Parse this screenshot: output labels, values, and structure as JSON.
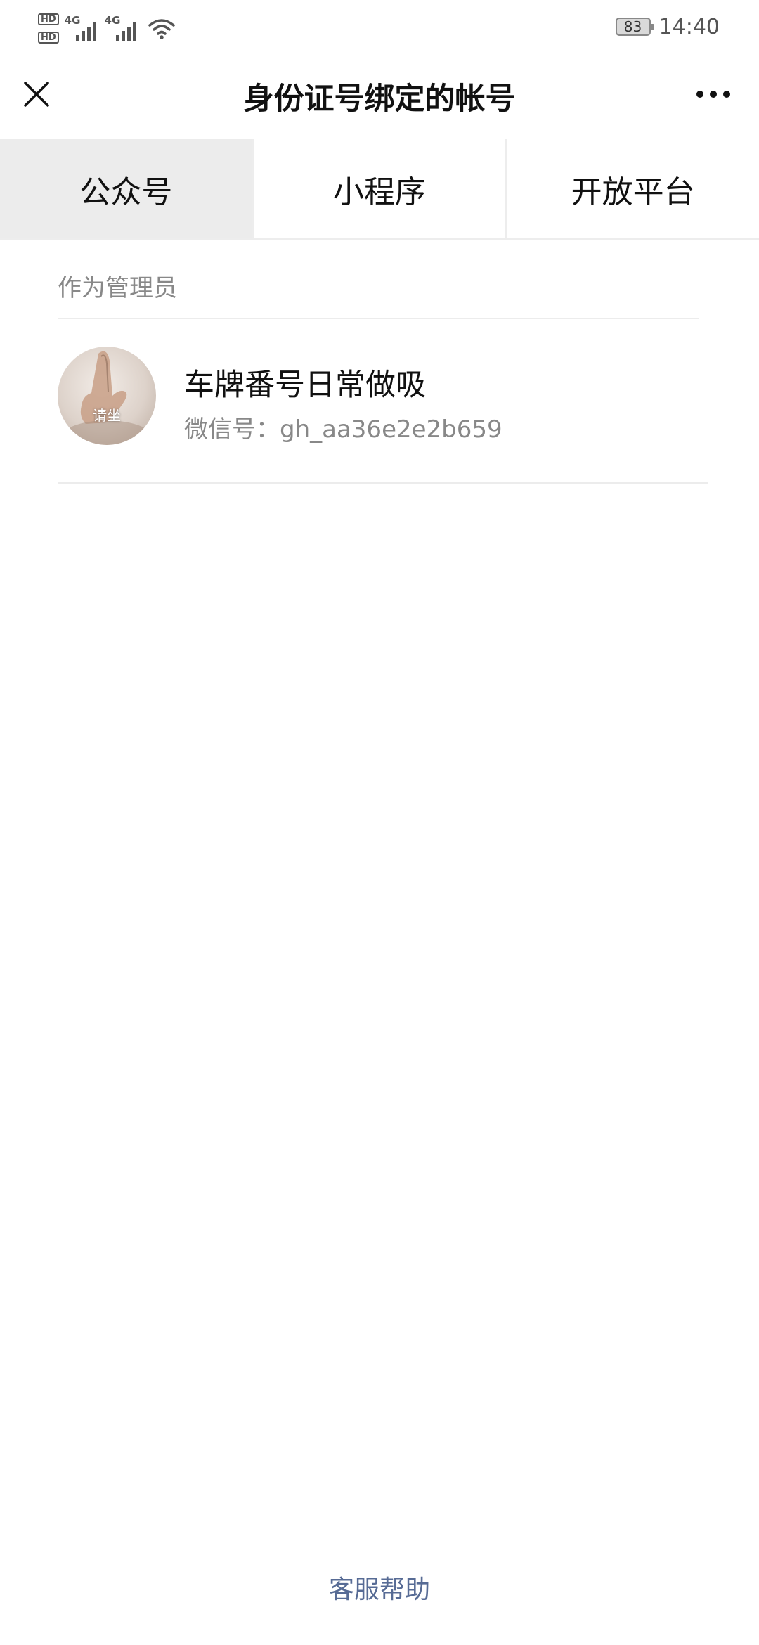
{
  "status_bar": {
    "hd_badges": [
      "HD",
      "HD"
    ],
    "sim_labels": [
      "4G",
      "4G"
    ],
    "battery_level": "83",
    "time": "14:40",
    "icons": [
      "hd-icon",
      "signal-icon",
      "signal-icon",
      "wifi-icon",
      "battery-icon"
    ]
  },
  "header": {
    "title": "身份证号绑定的帐号",
    "close_icon": "close-icon",
    "more_icon": "more-icon"
  },
  "tabs": [
    {
      "label": "公众号",
      "active": true
    },
    {
      "label": "小程序",
      "active": false
    },
    {
      "label": "开放平台",
      "active": false
    }
  ],
  "section": {
    "title": "作为管理员"
  },
  "accounts": [
    {
      "avatar_caption": "请坐",
      "name": "车牌番号日常做吸",
      "wechat_id": "微信号：gh_aa36e2e2b659"
    }
  ],
  "footer": {
    "help_link": "客服帮助"
  },
  "colors": {
    "background": "#ffffff",
    "active_tab_bg": "#ececec",
    "divider": "#ececec",
    "secondary_text": "#888888",
    "link": "#576b95"
  }
}
